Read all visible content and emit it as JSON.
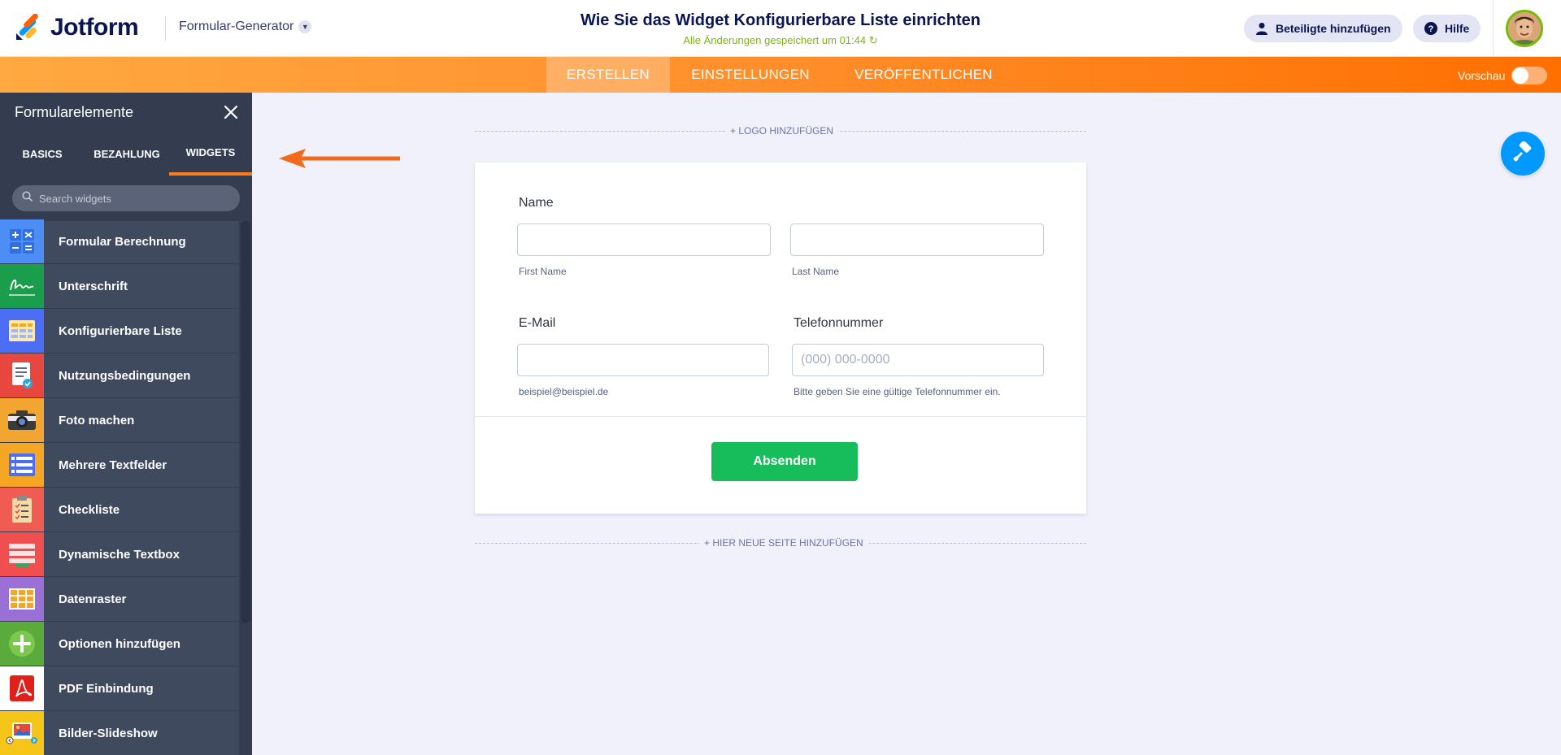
{
  "app": {
    "logo_text": "Jotform",
    "builder_label": "Formular-Generator"
  },
  "header": {
    "form_title": "Wie Sie das Widget Konfigurierbare Liste einrichten",
    "saved_status": "Alle Änderungen gespeichert um 01:44",
    "invite_label": "Beteiligte hinzufügen",
    "help_label": "Hilfe"
  },
  "nav": {
    "tabs": [
      {
        "label": "ERSTELLEN",
        "active": true
      },
      {
        "label": "EINSTELLUNGEN",
        "active": false
      },
      {
        "label": "VERÖFFENTLICHEN",
        "active": false
      }
    ],
    "preview_label": "Vorschau",
    "preview_on": false
  },
  "sidebar": {
    "title": "Formularelemente",
    "tabs": [
      {
        "label": "BASICS",
        "active": false
      },
      {
        "label": "BEZAHLUNG",
        "active": false
      },
      {
        "label": "WIDGETS",
        "active": true
      }
    ],
    "search_placeholder": "Search widgets",
    "items": [
      {
        "label": "Formular Berechnung",
        "icon": "calculator-icon",
        "color": "#4c8df6"
      },
      {
        "label": "Unterschrift",
        "icon": "signature-icon",
        "color": "#1a9e4b"
      },
      {
        "label": "Konfigurierbare Liste",
        "icon": "configurable-list-icon",
        "color": "#4b6ef5"
      },
      {
        "label": "Nutzungsbedingungen",
        "icon": "terms-document-icon",
        "color": "#e8473f"
      },
      {
        "label": "Foto machen",
        "icon": "camera-icon",
        "color": "#f3a531"
      },
      {
        "label": "Mehrere Textfelder",
        "icon": "multiple-textfields-icon",
        "color": "#f5a623"
      },
      {
        "label": "Checkliste",
        "icon": "checklist-icon",
        "color": "#f05b52"
      },
      {
        "label": "Dynamische Textbox",
        "icon": "dynamic-textbox-icon",
        "color": "#f04f4f"
      },
      {
        "label": "Datenraster",
        "icon": "data-grid-icon",
        "color": "#9a70d6"
      },
      {
        "label": "Optionen hinzufügen",
        "icon": "add-options-icon",
        "color": "#5aaa3c"
      },
      {
        "label": "PDF Einbindung",
        "icon": "pdf-icon",
        "color": "#ffffff"
      },
      {
        "label": "Bilder-Slideshow",
        "icon": "image-slideshow-icon",
        "color": "#f5c518"
      }
    ]
  },
  "canvas": {
    "add_logo_label": "+ LOGO HINZUFÜGEN",
    "add_page_label": "+ HIER NEUE SEITE HINZUFÜGEN"
  },
  "form": {
    "name_label": "Name",
    "first_name_sublabel": "First Name",
    "last_name_sublabel": "Last Name",
    "email_label": "E-Mail",
    "email_sublabel": "beispiel@beispiel.de",
    "phone_label": "Telefonnummer",
    "phone_placeholder": "(000) 000-0000",
    "phone_sublabel": "Bitte geben Sie eine gültige Telefonnummer ein.",
    "submit_label": "Absenden"
  },
  "colors": {
    "brand_navy": "#0a1551",
    "accent_orange": "#ff7b1c",
    "saved_green": "#78bb07",
    "submit_green": "#18bd5b",
    "fab_blue": "#0099ff",
    "sidebar_bg": "#404a5e"
  }
}
